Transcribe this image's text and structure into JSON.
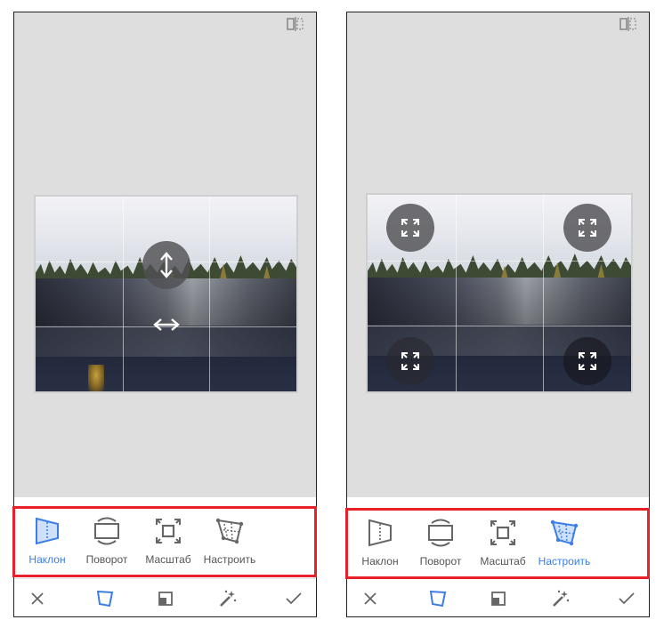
{
  "colors": {
    "accent": "#3c7ee6",
    "icon_gray": "#666666",
    "highlight_red": "#e8202a",
    "canvas_bg": "#dedede"
  },
  "screens": [
    {
      "active_tool": "tilt",
      "tools": [
        {
          "id": "tilt",
          "label": "Наклон",
          "icon": "tilt-icon",
          "active": true
        },
        {
          "id": "rotate",
          "label": "Поворот",
          "icon": "rotate-icon",
          "active": false
        },
        {
          "id": "scale",
          "label": "Масштаб",
          "icon": "scale-icon",
          "active": false
        },
        {
          "id": "adjust",
          "label": "Настроить",
          "icon": "free-transform-icon",
          "active": false
        }
      ],
      "handles": [
        "vertical-arrows-icon",
        "horizontal-arrows-icon"
      ]
    },
    {
      "active_tool": "adjust",
      "tools": [
        {
          "id": "tilt",
          "label": "Наклон",
          "icon": "tilt-icon",
          "active": false
        },
        {
          "id": "rotate",
          "label": "Поворот",
          "icon": "rotate-icon",
          "active": false
        },
        {
          "id": "scale",
          "label": "Масштаб",
          "icon": "scale-icon",
          "active": false
        },
        {
          "id": "adjust",
          "label": "Настроить",
          "icon": "free-transform-icon",
          "active": true
        }
      ],
      "handles": [
        "corner-top-left-icon",
        "corner-top-right-icon",
        "corner-bottom-left-icon",
        "corner-bottom-right-icon"
      ]
    }
  ],
  "bottom_bar": [
    "close-icon",
    "perspective-icon",
    "expand-icon",
    "auto-fix-icon",
    "apply-check-icon"
  ]
}
